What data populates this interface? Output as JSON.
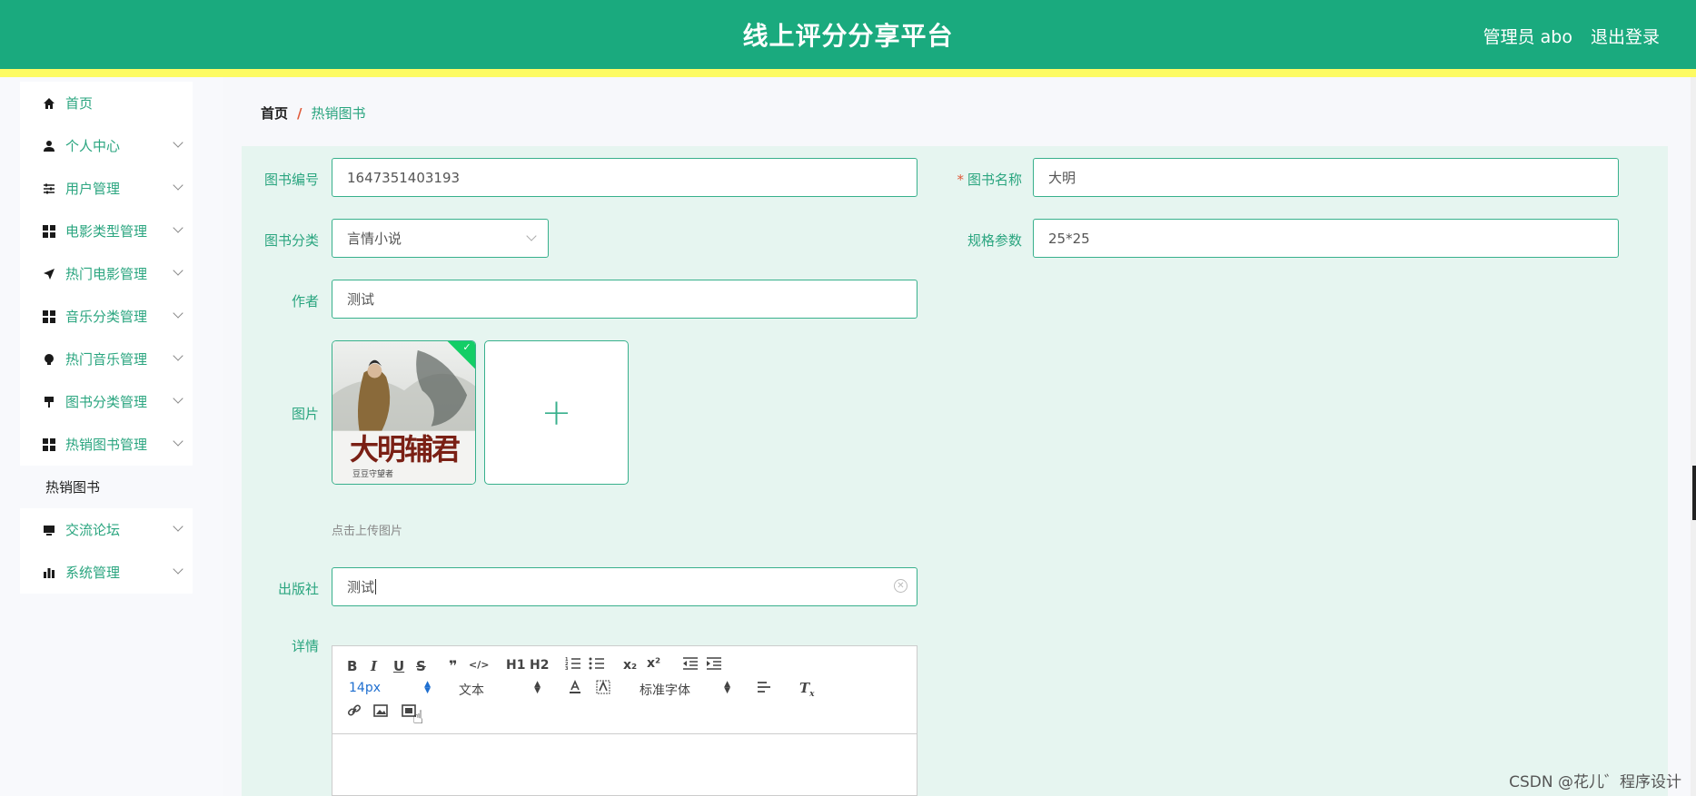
{
  "header": {
    "title": "线上评分分享平台",
    "user": "管理员 abo",
    "logout": "退出登录"
  },
  "sidebar": {
    "items": [
      {
        "label": "首页",
        "icon": "home-icon"
      },
      {
        "label": "个人中心",
        "icon": "user-icon"
      },
      {
        "label": "用户管理",
        "icon": "sliders-icon"
      },
      {
        "label": "电影类型管理",
        "icon": "grid-icon"
      },
      {
        "label": "热门电影管理",
        "icon": "paper-plane-icon"
      },
      {
        "label": "音乐分类管理",
        "icon": "grid-icon"
      },
      {
        "label": "热门音乐管理",
        "icon": "bulb-icon"
      },
      {
        "label": "图书分类管理",
        "icon": "brush-icon"
      },
      {
        "label": "热销图书管理",
        "icon": "grid-icon"
      },
      {
        "label": "热销图书",
        "icon": ""
      },
      {
        "label": "交流论坛",
        "icon": "monitor-icon"
      },
      {
        "label": "系统管理",
        "icon": "bar-chart-icon"
      }
    ]
  },
  "breadcrumb": {
    "home": "首页",
    "separator": "/",
    "current": "热销图书"
  },
  "form": {
    "book_no": {
      "label": "图书编号",
      "value": "1647351403193"
    },
    "book_name": {
      "label": "图书名称",
      "required_mark": "*",
      "value": "大明"
    },
    "category": {
      "label": "图书分类",
      "value": "言情小说"
    },
    "spec": {
      "label": "规格参数",
      "value": "25*25"
    },
    "author": {
      "label": "作者",
      "value": "测试"
    },
    "image": {
      "label": "图片",
      "upload_tip": "点击上传图片",
      "plus": "+",
      "thumb_title": "大明辅君",
      "thumb_author": "豆豆守望者"
    },
    "publisher": {
      "label": "出版社",
      "value": "测试"
    },
    "details": {
      "label": "详情"
    }
  },
  "editor": {
    "toolbar_row1": [
      "B",
      "I",
      "U",
      "S",
      "99",
      "</>",
      "H1",
      "H2",
      "ol",
      "ul",
      "x₂",
      "x²",
      "outdent",
      "indent"
    ],
    "font_size": "14px",
    "text_style": "文本",
    "font_family": "标准字体"
  },
  "watermark": "CSDN @花儿゛程序设计",
  "colors": {
    "primary": "#1aaa7e",
    "stripe": "#fdfb63",
    "panel": "#e6f5f0",
    "accent_text": "#2aa57f"
  }
}
